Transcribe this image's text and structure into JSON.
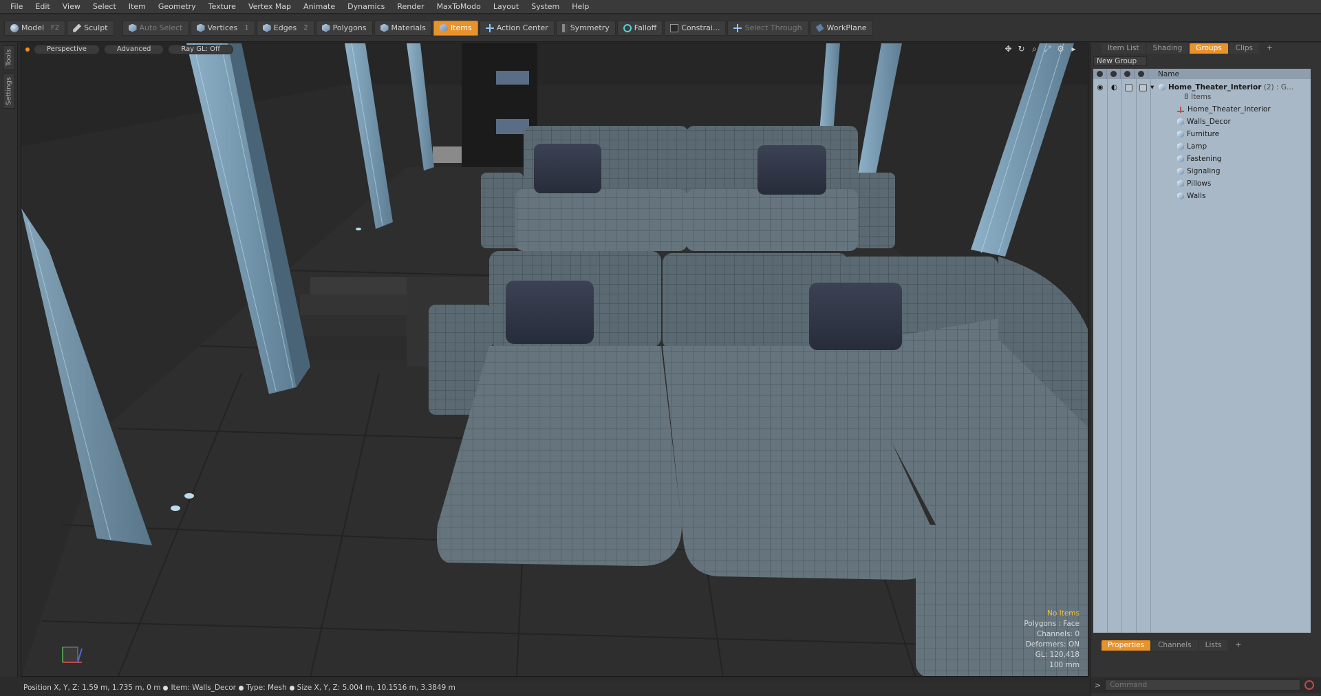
{
  "menu": [
    "File",
    "Edit",
    "View",
    "Select",
    "Item",
    "Geometry",
    "Texture",
    "Vertex Map",
    "Animate",
    "Dynamics",
    "Render",
    "MaxToModo",
    "Layout",
    "System",
    "Help"
  ],
  "toolbar": {
    "model": "Model",
    "model_key": "F2",
    "sculpt": "Sculpt",
    "auto_select": "Auto Select",
    "vertices": "Vertices",
    "vertices_key": "1",
    "edges": "Edges",
    "edges_key": "2",
    "polygons": "Polygons",
    "materials": "Materials",
    "items": "Items",
    "action_center": "Action Center",
    "symmetry": "Symmetry",
    "falloff": "Falloff",
    "constraints": "Constrai...",
    "select_through": "Select Through",
    "workplane": "WorkPlane"
  },
  "left_tabs": [
    "Tools",
    "Settings"
  ],
  "viewport": {
    "view": "Perspective",
    "shading": "Advanced",
    "raygl": "Ray GL: Off",
    "hud": {
      "selection": "No Items",
      "polygons": "Polygons : Face",
      "channels": "Channels: 0",
      "deformers": "Deformers: ON",
      "gl": "GL: 120,418",
      "units": "100 mm"
    }
  },
  "top_panel_tabs": [
    "Item List",
    "Shading",
    "Groups",
    "Clips",
    "+"
  ],
  "active_top_tab": "Groups",
  "new_group_label": "New Group",
  "groups": {
    "header_name": "Name",
    "root": "Home_Theater_Interior",
    "root_suffix": "(2) : G...",
    "root_count": "8 Items",
    "children": [
      "Home_Theater_Interior",
      "Walls_Decor",
      "Furniture",
      "Lamp",
      "Fastening",
      "Signaling",
      "Pillows",
      "Walls"
    ]
  },
  "bottom_panel_tabs": [
    "Properties",
    "Channels",
    "Lists",
    "+"
  ],
  "active_bottom_tab": "Properties",
  "command_placeholder": "Command",
  "status": {
    "position_label": "Position X, Y, Z:",
    "position_value": "1.59 m, 1.735 m, 0 m",
    "item_label": "Item:",
    "item_value": "Walls_Decor",
    "type_label": "Type:",
    "type_value": "Mesh",
    "size_label": "Size X, Y, Z:",
    "size_value": "5.004 m, 10.1516 m, 3.3849 m"
  },
  "colors": {
    "accent": "#e8922a",
    "panel_bg": "#333333",
    "group_list_bg": "#a9b8c6",
    "hud_warning": "#f0c23a",
    "sofa": "#5c6b73"
  }
}
